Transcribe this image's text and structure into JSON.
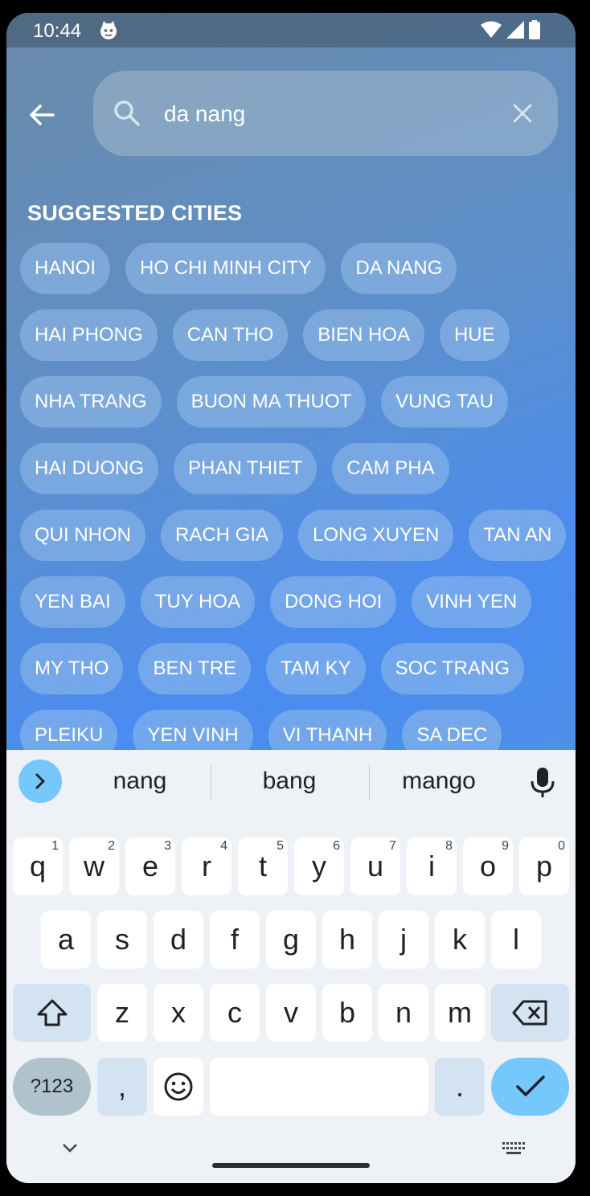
{
  "status_bar": {
    "time": "10:44"
  },
  "search": {
    "value": "da nang",
    "placeholder": ""
  },
  "suggested": {
    "title": "SUGGESTED CITIES",
    "rows": [
      [
        "HANOI",
        "HO CHI MINH CITY",
        "DA NANG"
      ],
      [
        "HAI PHONG",
        "CAN THO",
        "BIEN HOA",
        "HUE"
      ],
      [
        "NHA TRANG",
        "BUON MA THUOT",
        "VUNG TAU"
      ],
      [
        "HAI DUONG",
        "PHAN THIET",
        "CAM PHA"
      ],
      [
        "QUI NHON",
        "RACH GIA",
        "LONG XUYEN",
        "TAN AN"
      ],
      [
        "YEN BAI",
        "TUY HOA",
        "DONG HOI",
        "VINH YEN"
      ],
      [
        "MY THO",
        "BEN TRE",
        "TAM KY",
        "SOC TRANG"
      ],
      [
        "PLEIKU",
        "YEN VINH",
        "VI THANH",
        "SA DEC"
      ]
    ]
  },
  "keyboard": {
    "suggestions": [
      "nang",
      "bang",
      "mango"
    ],
    "row1": [
      {
        "k": "q",
        "h": "1"
      },
      {
        "k": "w",
        "h": "2"
      },
      {
        "k": "e",
        "h": "3"
      },
      {
        "k": "r",
        "h": "4"
      },
      {
        "k": "t",
        "h": "5"
      },
      {
        "k": "y",
        "h": "6"
      },
      {
        "k": "u",
        "h": "7"
      },
      {
        "k": "i",
        "h": "8"
      },
      {
        "k": "o",
        "h": "9"
      },
      {
        "k": "p",
        "h": "0"
      }
    ],
    "row2": [
      "a",
      "s",
      "d",
      "f",
      "g",
      "h",
      "j",
      "k",
      "l"
    ],
    "row3": [
      "z",
      "x",
      "c",
      "v",
      "b",
      "n",
      "m"
    ],
    "symbols_label": "?123",
    "comma": ",",
    "period": "."
  },
  "colors": {
    "accent": "#74c8fb",
    "chip_bg": "#96beeb"
  },
  "icons": [
    "back-arrow-icon",
    "search-icon",
    "clear-icon",
    "chevron-right-icon",
    "mic-icon",
    "shift-icon",
    "backspace-icon",
    "emoji-icon",
    "check-icon",
    "chevron-down-icon",
    "keyboard-icon"
  ]
}
